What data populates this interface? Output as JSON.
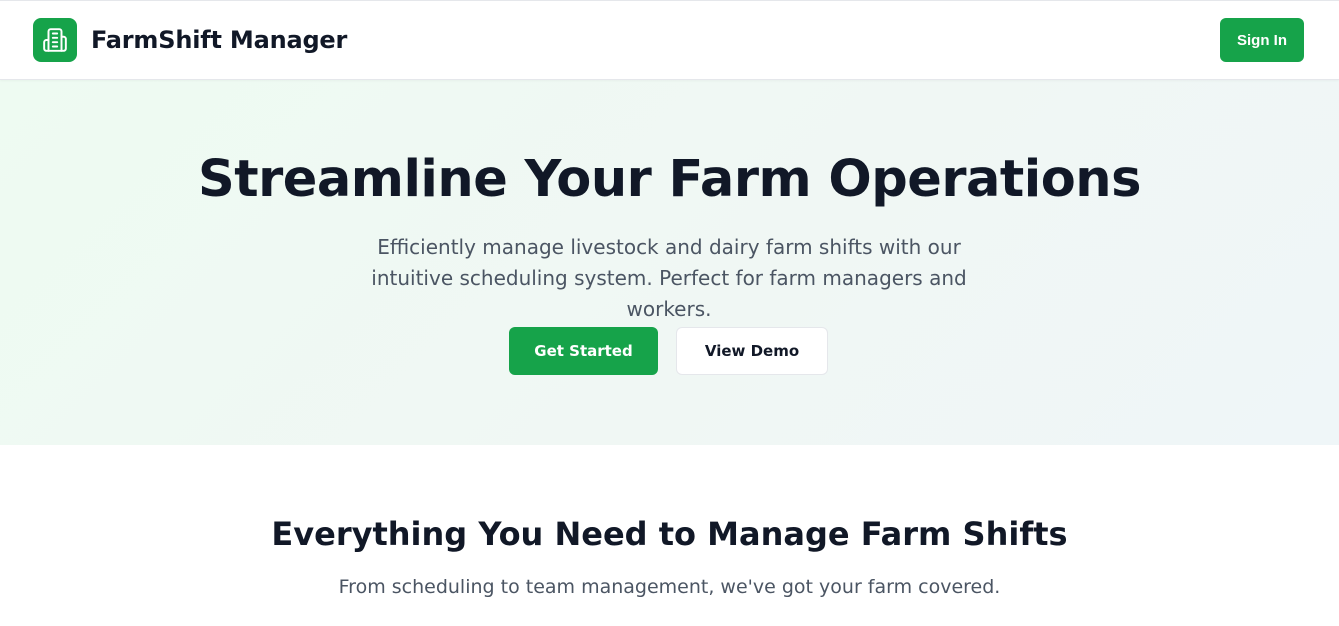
{
  "header": {
    "brand": "FarmShift Manager",
    "logo_icon": "building-icon",
    "signin_label": "Sign In"
  },
  "hero": {
    "title": "Streamline Your Farm Operations",
    "subtitle": "Efficiently manage livestock and dairy farm shifts with our intuitive scheduling system. Perfect for farm managers and workers.",
    "primary_cta": "Get Started",
    "secondary_cta": "View Demo"
  },
  "features": {
    "title": "Everything You Need to Manage Farm Shifts",
    "subtitle": "From scheduling to team management, we've got your farm covered."
  },
  "colors": {
    "accent": "#16a34a",
    "heading": "#111827",
    "body_text": "#4b5563"
  }
}
